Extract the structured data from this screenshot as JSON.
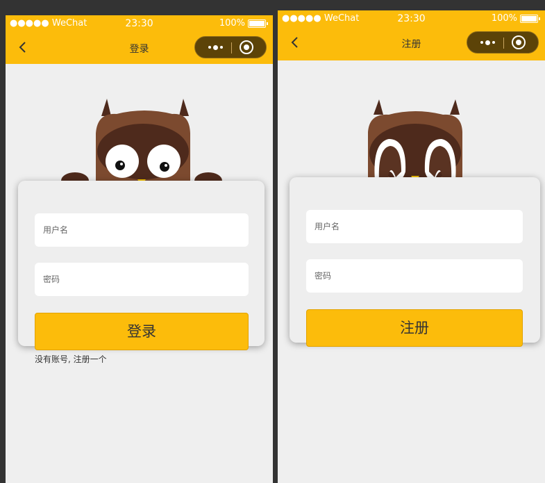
{
  "screens": [
    {
      "status": {
        "carrier": "●●●●● WeChat",
        "time": "23:30",
        "battery": "100%"
      },
      "nav": {
        "title": "登录"
      },
      "form": {
        "username_placeholder": "用户名",
        "password_placeholder": "密码",
        "submit_label": "登录"
      },
      "footer_link": "没有账号, 注册一个"
    },
    {
      "status": {
        "carrier": "●●●●● WeChat",
        "time": "23:30",
        "battery": "100%"
      },
      "nav": {
        "title": "注册"
      },
      "form": {
        "username_placeholder": "用户名",
        "password_placeholder": "密码",
        "submit_label": "注册"
      }
    }
  ],
  "colors": {
    "accent": "#fcbc0b",
    "capsule": "#5c4308",
    "owl_body": "#7c4a2f",
    "owl_dark": "#4e2a1c",
    "beak": "#f2c000",
    "background": "#333333",
    "page": "#efefef"
  },
  "icons": [
    "back-icon",
    "more-icon",
    "close-icon",
    "wifi-icon",
    "battery-icon",
    "owl-mascot"
  ]
}
